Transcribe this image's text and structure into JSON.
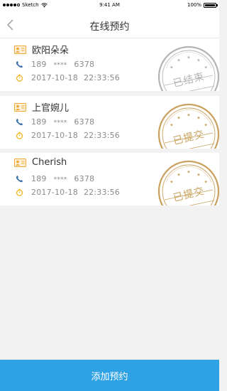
{
  "status_bar": {
    "carrier": "Sketch",
    "time": "9:41 AM",
    "battery": "100%"
  },
  "nav": {
    "title": "在线预约",
    "back_icon": "chevron-left-icon"
  },
  "cards": [
    {
      "name": "欧阳朵朵",
      "phone_prefix": "189",
      "phone_mask": "****",
      "phone_suffix": "6378",
      "date": "2017-10-18",
      "time": "22:33:56",
      "stamp_text": "已结束",
      "stamp_color": "#b4b4b4"
    },
    {
      "name": "上官婉儿",
      "phone_prefix": "189",
      "phone_mask": "****",
      "phone_suffix": "6378",
      "date": "2017-10-18",
      "time": "22:33:56",
      "stamp_text": "已提交",
      "stamp_color": "#c9a15e"
    },
    {
      "name": "Cherish",
      "phone_prefix": "189",
      "phone_mask": "****",
      "phone_suffix": "6378",
      "date": "2017-10-18",
      "time": "22:33:56",
      "stamp_text": "已提交",
      "stamp_color": "#c9a15e"
    }
  ],
  "footer": {
    "button_label": "添加预约",
    "button_color": "#2fa2e6"
  },
  "colors": {
    "id_icon": "#f0a830",
    "phone_icon": "#3d6fae",
    "clock_icon": "#f2b21e"
  }
}
